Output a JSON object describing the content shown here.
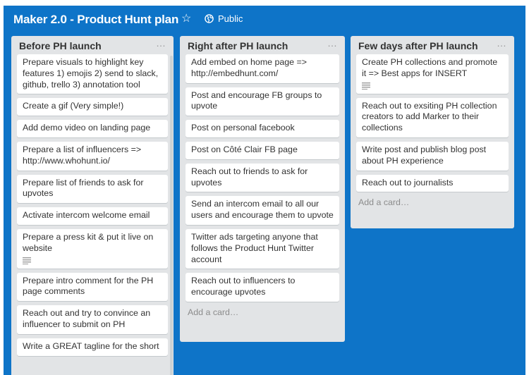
{
  "board": {
    "title": "Maker 2.0 - Product Hunt plan",
    "visibility": "Public",
    "star_icon": "star-icon",
    "visibility_icon": "globe-icon",
    "background_color": "#0e74c8"
  },
  "lists": [
    {
      "title": "Before PH launch",
      "menu": "…",
      "cards": [
        {
          "text": "Prepare visuals to highlight key features 1) emojis 2) send to slack, github, trello 3) annotation tool",
          "has_description": false
        },
        {
          "text": "Create a gif (Very simple!)",
          "has_description": false
        },
        {
          "text": "Add demo video on landing page",
          "has_description": false
        },
        {
          "text": "Prepare a list of influencers => http://www.whohunt.io/",
          "has_description": false
        },
        {
          "text": "Prepare list of friends to ask for upvotes",
          "has_description": false
        },
        {
          "text": "Activate intercom welcome email",
          "has_description": false
        },
        {
          "text": "Prepare a press kit & put it live on website",
          "has_description": true
        },
        {
          "text": "Prepare intro comment for the PH page comments",
          "has_description": false
        },
        {
          "text": "Reach out and try to convince an influencer to submit on PH",
          "has_description": false
        },
        {
          "text": "Write a GREAT tagline for the short",
          "has_description": false
        }
      ]
    },
    {
      "title": "Right after PH launch",
      "menu": "…",
      "cards": [
        {
          "text": "Add embed on home page => http://embedhunt.com/",
          "has_description": false
        },
        {
          "text": "Post and encourage FB groups to upvote",
          "has_description": false
        },
        {
          "text": "Post on personal facebook",
          "has_description": false
        },
        {
          "text": "Post on Côté Clair FB page",
          "has_description": false
        },
        {
          "text": "Reach out to friends to ask for upvotes",
          "has_description": false
        },
        {
          "text": "Send an intercom email to all our users and encourage them to upvote",
          "has_description": false
        },
        {
          "text": "Twitter ads targeting anyone that follows the Product Hunt Twitter account",
          "has_description": false
        },
        {
          "text": "Reach out to influencers to encourage upvotes",
          "has_description": false
        }
      ],
      "add_card": "Add a card…"
    },
    {
      "title": "Few days after PH launch",
      "menu": "…",
      "cards": [
        {
          "text": "Create PH collections and promote it => Best apps for INSERT",
          "has_description": true
        },
        {
          "text": "Reach out to exsiting PH collection creators to add Marker to their collections",
          "has_description": false
        },
        {
          "text": "Write post and publish blog post about PH experience",
          "has_description": false
        },
        {
          "text": "Reach out to journalists",
          "has_description": false
        }
      ],
      "add_card": "Add a card…"
    }
  ]
}
